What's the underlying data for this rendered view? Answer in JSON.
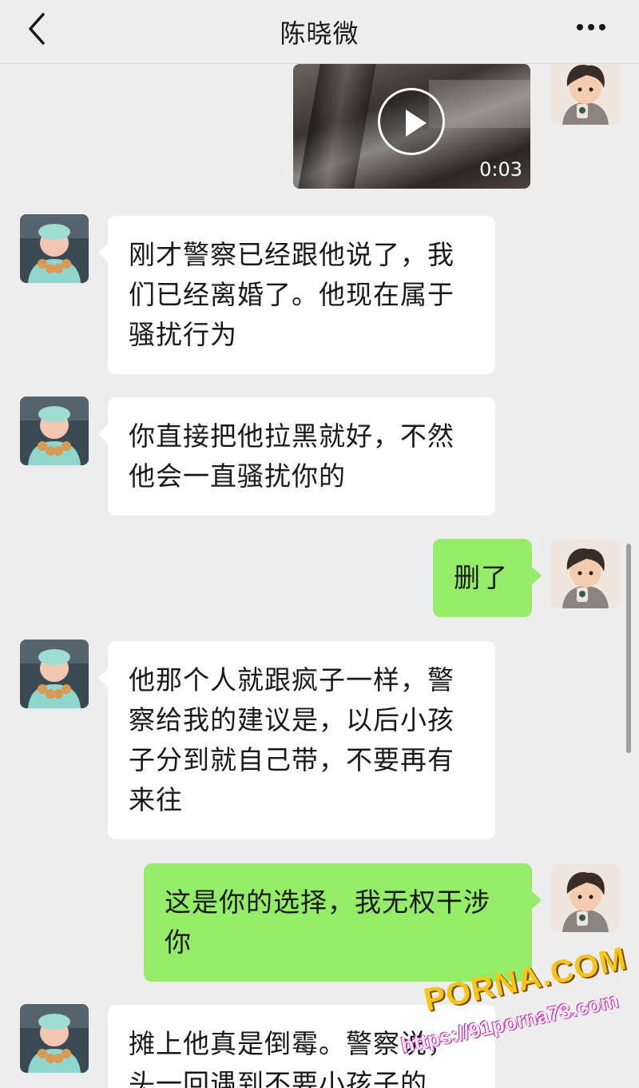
{
  "header": {
    "title": "陈晓微"
  },
  "video": {
    "duration": "0:03"
  },
  "messages": [
    {
      "from": "contact",
      "text": "刚才警察已经跟他说了，我们已经离婚了。他现在属于骚扰行为"
    },
    {
      "from": "contact",
      "text": "你直接把他拉黑就好，不然他会一直骚扰你的"
    },
    {
      "from": "me",
      "text": "删了"
    },
    {
      "from": "contact",
      "text": "他那个人就跟疯子一样，警察给我的建议是，以后小孩子分到就自己带，不要再有来往"
    },
    {
      "from": "me",
      "text": "这是你的选择，我无权干涉你"
    },
    {
      "from": "contact",
      "text": "摊上他真是倒霉。警察说，头一回遇到不要小孩子的"
    }
  ],
  "watermark": {
    "brand": "PORNA.COM",
    "url": "https://91porna73.com"
  },
  "colors": {
    "background": "#ededed",
    "incoming_bubble": "#ffffff",
    "outgoing_bubble": "#95ec69"
  }
}
